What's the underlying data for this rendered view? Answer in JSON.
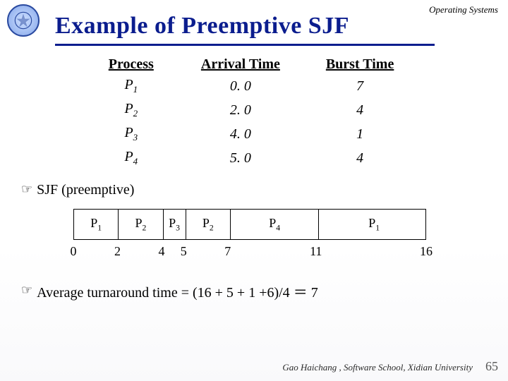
{
  "header": {
    "course": "Operating Systems",
    "title": "Example of Preemptive SJF"
  },
  "table": {
    "headers": {
      "process": "Process",
      "arrival": "Arrival Time",
      "burst": "Burst Time"
    },
    "rows": [
      {
        "p_prefix": "P",
        "p_sub": "1",
        "arrival": "0. 0",
        "burst": "7"
      },
      {
        "p_prefix": "P",
        "p_sub": "2",
        "arrival": "2. 0",
        "burst": "4"
      },
      {
        "p_prefix": "P",
        "p_sub": "3",
        "arrival": "4. 0",
        "burst": "1"
      },
      {
        "p_prefix": "P",
        "p_sub": "4",
        "arrival": "5. 0",
        "burst": "4"
      }
    ]
  },
  "bullets": {
    "sjf": "SJF (preemptive)",
    "avg_prefix": "Average turnaround time = (16 + 5 + 1 +6)/4 ",
    "avg_eq": "＝",
    "avg_result": " 7"
  },
  "gantt": {
    "total": 16,
    "segments": [
      {
        "p_prefix": "P",
        "p_sub": "1",
        "start": 0,
        "end": 2
      },
      {
        "p_prefix": "P",
        "p_sub": "2",
        "start": 2,
        "end": 4
      },
      {
        "p_prefix": "P",
        "p_sub": "3",
        "start": 4,
        "end": 5
      },
      {
        "p_prefix": "P",
        "p_sub": "2",
        "start": 5,
        "end": 7
      },
      {
        "p_prefix": "P",
        "p_sub": "4",
        "start": 7,
        "end": 11
      },
      {
        "p_prefix": "P",
        "p_sub": "1",
        "start": 11,
        "end": 16
      }
    ],
    "ticks": [
      0,
      2,
      4,
      5,
      7,
      11,
      16
    ]
  },
  "footer": {
    "credit": "Gao Haichang , Software School,  Xidian University",
    "page": "65"
  },
  "chart_data": {
    "type": "table",
    "title": "Example of Preemptive SJF",
    "columns": [
      "Process",
      "Arrival Time",
      "Burst Time"
    ],
    "rows": [
      [
        "P1",
        0.0,
        7
      ],
      [
        "P2",
        2.0,
        4
      ],
      [
        "P3",
        4.0,
        1
      ],
      [
        "P4",
        5.0,
        4
      ]
    ],
    "gantt_schedule": [
      {
        "process": "P1",
        "start": 0,
        "end": 2
      },
      {
        "process": "P2",
        "start": 2,
        "end": 4
      },
      {
        "process": "P3",
        "start": 4,
        "end": 5
      },
      {
        "process": "P2",
        "start": 5,
        "end": 7
      },
      {
        "process": "P4",
        "start": 7,
        "end": 11
      },
      {
        "process": "P1",
        "start": 11,
        "end": 16
      }
    ],
    "average_turnaround_formula": "(16 + 5 + 1 + 6) / 4",
    "average_turnaround_value": 7
  }
}
